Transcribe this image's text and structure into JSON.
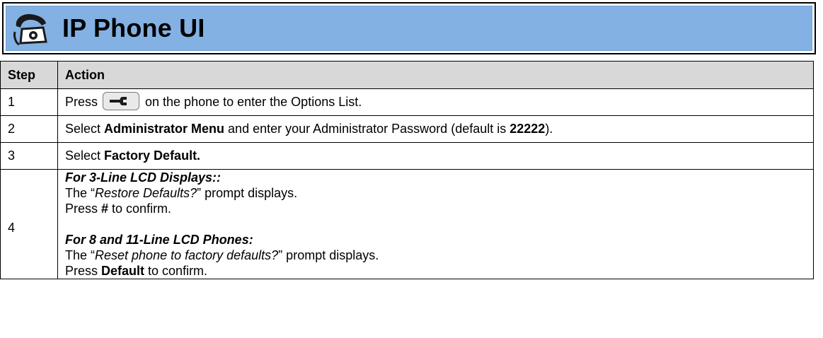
{
  "header": {
    "icon": "phone-icon",
    "title": "IP Phone UI"
  },
  "table": {
    "col_step": "Step",
    "col_action": "Action",
    "rows": [
      {
        "step": "1",
        "press": "Press",
        "key_icon": "options-key-icon",
        "rest": "on the phone to enter the Options List."
      },
      {
        "step": "2",
        "t1": "Select ",
        "b1": "Administrator Menu",
        "t2": " and enter your Administrator Password (default is ",
        "b2": "22222",
        "t3": ")."
      },
      {
        "step": "3",
        "t1": "Select ",
        "b1": "Factory Default."
      },
      {
        "step": "4",
        "h1": "For 3-Line LCD Displays::",
        "l1a": "The “",
        "l1b": "Restore Defaults?",
        "l1c": "” prompt displays.",
        "l2a": "Press ",
        "l2b": "#",
        "l2c": " to confirm.",
        "h2": "For 8 and 11-Line LCD Phones:",
        "l3a": "The “",
        "l3b": "Reset phone to factory defaults?",
        "l3c": "” prompt displays.",
        "l4a": "Press ",
        "l4b": "Default",
        "l4c": " to confirm."
      }
    ]
  }
}
